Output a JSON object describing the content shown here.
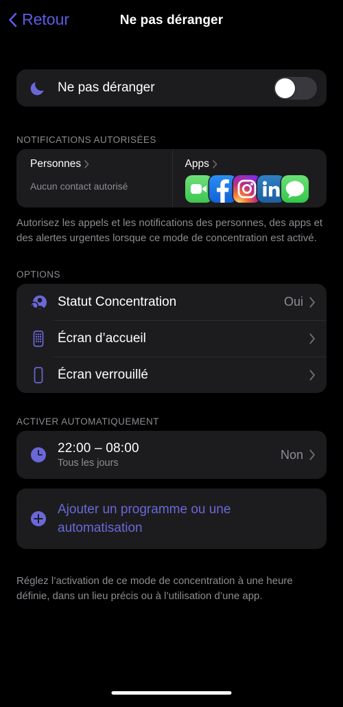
{
  "nav": {
    "back_label": "Retour",
    "title": "Ne pas déranger"
  },
  "main_toggle": {
    "label": "Ne pas déranger",
    "icon": "moon-icon",
    "state": "off"
  },
  "allowed_notifications": {
    "header": "NOTIFICATIONS AUTORISÉES",
    "people": {
      "title": "Personnes",
      "subtitle": "Aucun contact autorisé"
    },
    "apps": {
      "title": "Apps",
      "icons": [
        {
          "name": "facetime-app-icon",
          "label": "FaceTime"
        },
        {
          "name": "facebook-app-icon",
          "label": "Facebook"
        },
        {
          "name": "instagram-app-icon",
          "label": "Instagram"
        },
        {
          "name": "linkedin-app-icon",
          "label": "LinkedIn"
        },
        {
          "name": "messages-app-icon",
          "label": "Messages"
        }
      ]
    },
    "footer": "Autorisez les appels et les notifications des personnes, des apps et des alertes urgentes lorsque ce mode de concentration est activé."
  },
  "options": {
    "header": "OPTIONS",
    "rows": [
      {
        "label": "Statut Concentration",
        "value": "Oui",
        "icon": "focus-status-icon"
      },
      {
        "label": "Écran d’accueil",
        "value": "",
        "icon": "home-screen-icon"
      },
      {
        "label": "Écran verrouillé",
        "value": "",
        "icon": "lock-screen-icon"
      }
    ]
  },
  "automation": {
    "header": "ACTIVER AUTOMATIQUEMENT",
    "schedule": {
      "time": "22:00 – 08:00",
      "days": "Tous les jours",
      "value": "Non",
      "icon": "clock-icon"
    },
    "add": {
      "label": "Ajouter un programme ou une automatisation",
      "icon": "plus-circle-icon"
    },
    "footer": "Réglez l’activation de ce mode de concentration à une heure définie, dans un lieu précis ou à l’utilisation d’une app."
  },
  "colors": {
    "accent_blue": "#5e5ce6",
    "accent_purple": "#6a68d8",
    "card_bg": "#1c1c1e",
    "page_bg": "#000000",
    "secondary_text": "#8d8d93"
  }
}
